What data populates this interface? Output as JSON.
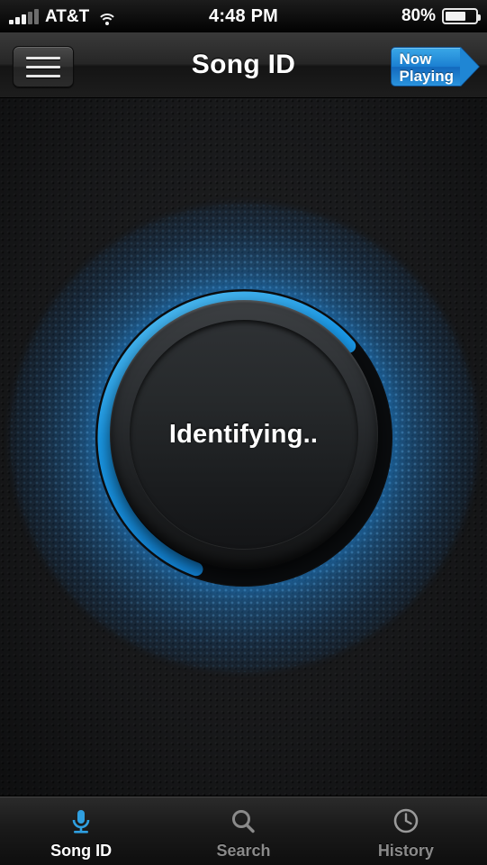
{
  "status_bar": {
    "carrier": "AT&T",
    "signal_bars_filled": 3,
    "signal_bars_total": 5,
    "wifi_icon": "wifi-icon",
    "time": "4:48 PM",
    "battery_percent": "80%",
    "battery_level": 80
  },
  "nav_bar": {
    "menu_button_icon": "hamburger-menu-icon",
    "title": "Song ID",
    "now_playing_line1": "Now",
    "now_playing_line2": "Playing",
    "now_playing_accent": "#1f86d4"
  },
  "main": {
    "dial_label": "Identifying..",
    "progress_percent": 58,
    "progress_color": "#1b9ae8",
    "glow_color": "#2d96e6",
    "background_color": "#1f2022"
  },
  "tab_bar": {
    "items": [
      {
        "label": "Song ID",
        "icon": "microphone-icon",
        "active": true
      },
      {
        "label": "Search",
        "icon": "search-icon",
        "active": false
      },
      {
        "label": "History",
        "icon": "clock-icon",
        "active": false
      }
    ]
  }
}
